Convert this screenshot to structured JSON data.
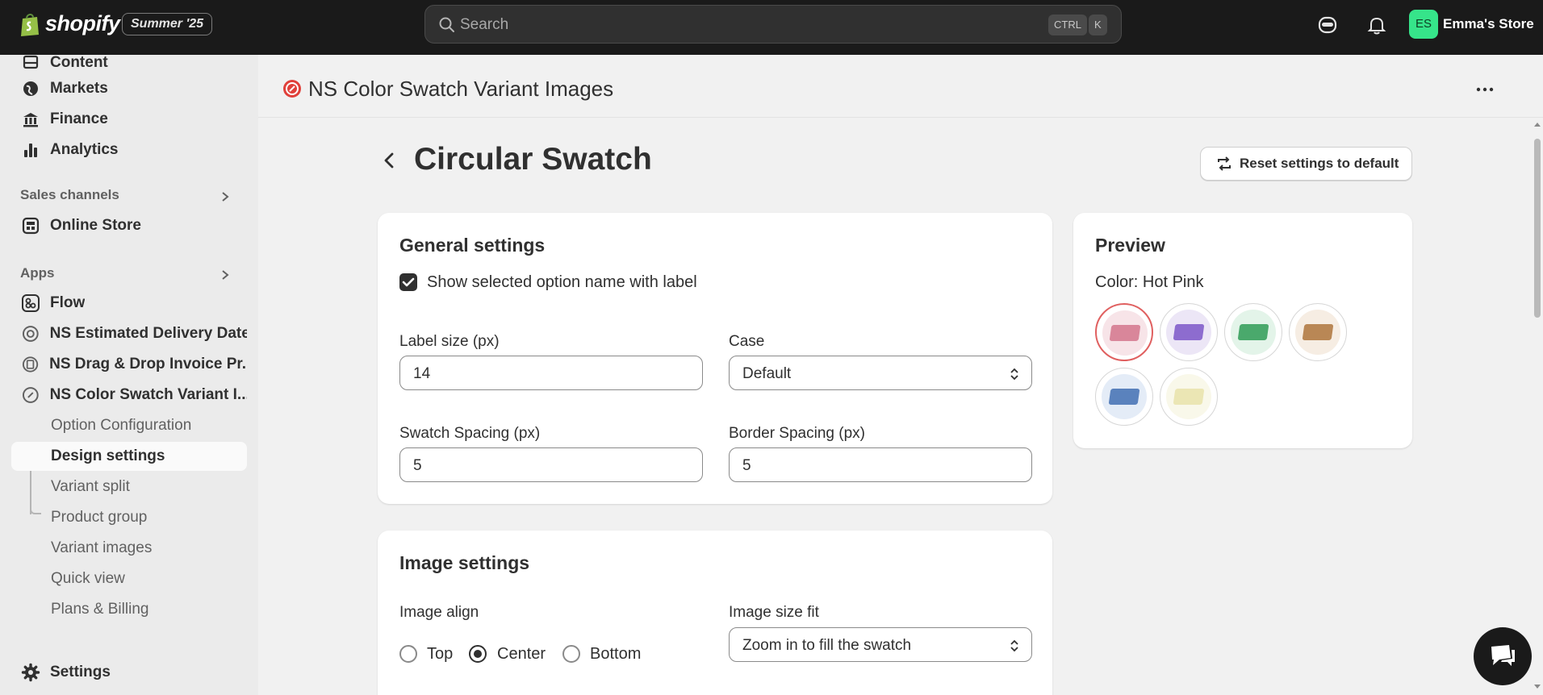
{
  "topbar": {
    "brand": "shopify",
    "badge": "Summer '25",
    "search_placeholder": "Search",
    "kbd_ctrl": "CTRL",
    "kbd_k": "K",
    "store_initials": "ES",
    "store_name": "Emma's Store"
  },
  "sidebar": {
    "items": [
      {
        "label": "Content",
        "icon": "content-icon"
      },
      {
        "label": "Markets",
        "icon": "globe-icon"
      },
      {
        "label": "Finance",
        "icon": "bank-icon"
      },
      {
        "label": "Analytics",
        "icon": "bar-chart-icon"
      }
    ],
    "sales_channels_label": "Sales channels",
    "online_store_label": "Online Store",
    "apps_label": "Apps",
    "apps": [
      {
        "label": "Flow"
      },
      {
        "label": "NS Estimated Delivery Date"
      },
      {
        "label": "NS Drag & Drop Invoice Pr..."
      },
      {
        "label": "NS Color Swatch Variant I..."
      }
    ],
    "sub_items": [
      {
        "label": "Option Configuration"
      },
      {
        "label": "Design settings"
      },
      {
        "label": "Variant split"
      },
      {
        "label": "Product group"
      },
      {
        "label": "Variant images"
      },
      {
        "label": "Quick view"
      },
      {
        "label": "Plans & Billing"
      }
    ],
    "settings_label": "Settings"
  },
  "header": {
    "app_title": "NS Color Swatch Variant Images"
  },
  "page": {
    "title": "Circular Swatch",
    "reset_label": "Reset settings to default"
  },
  "general": {
    "title": "General settings",
    "show_label_text": "Show selected option name with label",
    "show_label_checked": true,
    "label_size_label": "Label size (px)",
    "label_size_value": "14",
    "case_label": "Case",
    "case_value": "Default",
    "swatch_spacing_label": "Swatch Spacing (px)",
    "swatch_spacing_value": "5",
    "border_spacing_label": "Border Spacing (px)",
    "border_spacing_value": "5"
  },
  "image": {
    "title": "Image settings",
    "align_label": "Image align",
    "align_options": [
      "Top",
      "Center",
      "Bottom"
    ],
    "align_selected": "Center",
    "size_fit_label": "Image size fit",
    "size_fit_value": "Zoom in to fill the swatch"
  },
  "preview": {
    "title": "Preview",
    "color_label": "Color: Hot Pink",
    "swatches": [
      {
        "name": "hot-pink",
        "bg": "#f7e4e8",
        "fabric": "#d9869a",
        "selected": true
      },
      {
        "name": "purple",
        "bg": "#ece6f6",
        "fabric": "#8d6ccf",
        "selected": false
      },
      {
        "name": "green",
        "bg": "#e3f4e9",
        "fabric": "#4aa96c",
        "selected": false
      },
      {
        "name": "brown",
        "bg": "#f6ede3",
        "fabric": "#b98755",
        "selected": false
      },
      {
        "name": "blue",
        "bg": "#e4ecf7",
        "fabric": "#5a82bd",
        "selected": false
      },
      {
        "name": "cream",
        "bg": "#f9f8ea",
        "fabric": "#ebe6b4",
        "selected": false
      }
    ]
  },
  "colors": {
    "topbar_bg": "#1a1a1a",
    "store_avatar": "#36e48a",
    "selected_swatch_ring": "#e06060",
    "app_icon_red": "#e0403a"
  }
}
